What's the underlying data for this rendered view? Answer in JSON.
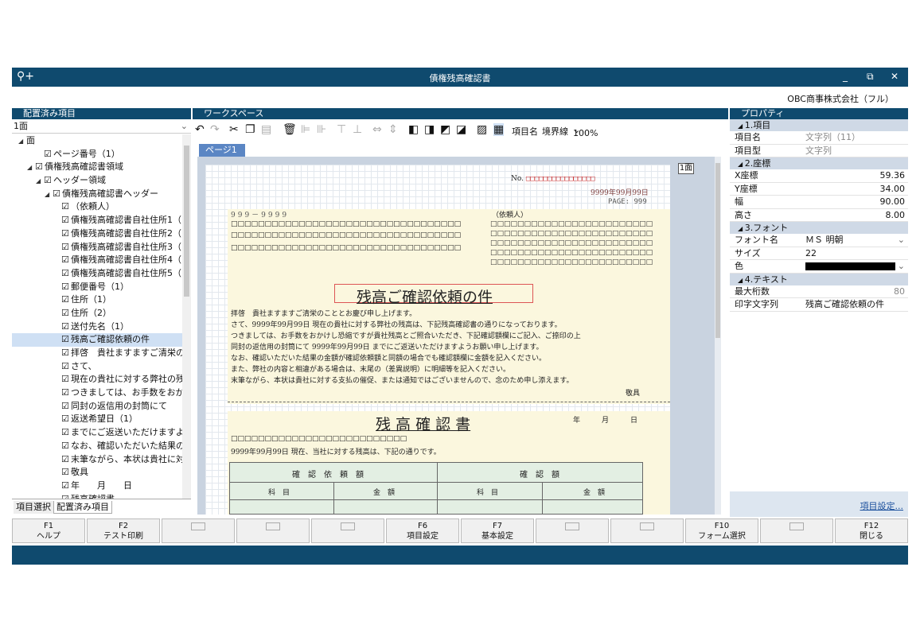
{
  "window": {
    "title": "債権残高確認書",
    "company": "OBC商事株式会社（フル）"
  },
  "left_pane": {
    "header": "配置済み項目",
    "page_select": "1面",
    "tree": [
      {
        "label": "面",
        "level": 0,
        "toggle": "◢",
        "checkbox": false
      },
      {
        "label": "ページ番号（1）",
        "level": 2,
        "toggle": "",
        "checkbox": true
      },
      {
        "label": "債権残高確認書領域",
        "level": 1,
        "toggle": "◢",
        "checkbox": true
      },
      {
        "label": "ヘッダー領域",
        "level": 2,
        "toggle": "◢",
        "checkbox": true
      },
      {
        "label": "債権残高確認書ヘッダー",
        "level": 3,
        "toggle": "◢",
        "checkbox": true
      },
      {
        "label": "（依頼人）",
        "level": 4,
        "toggle": "",
        "checkbox": true
      },
      {
        "label": "債権残高確認書自社住所1（",
        "level": 4,
        "toggle": "",
        "checkbox": true
      },
      {
        "label": "債権残高確認書自社住所2（",
        "level": 4,
        "toggle": "",
        "checkbox": true
      },
      {
        "label": "債権残高確認書自社住所3（",
        "level": 4,
        "toggle": "",
        "checkbox": true
      },
      {
        "label": "債権残高確認書自社住所4（",
        "level": 4,
        "toggle": "",
        "checkbox": true
      },
      {
        "label": "債権残高確認書自社住所5（",
        "level": 4,
        "toggle": "",
        "checkbox": true
      },
      {
        "label": "郵便番号（1）",
        "level": 4,
        "toggle": "",
        "checkbox": true
      },
      {
        "label": "住所（1）",
        "level": 4,
        "toggle": "",
        "checkbox": true
      },
      {
        "label": "住所（2）",
        "level": 4,
        "toggle": "",
        "checkbox": true
      },
      {
        "label": "送付先名（1）",
        "level": 4,
        "toggle": "",
        "checkbox": true
      },
      {
        "label": "残高ご確認依頼の件",
        "level": 4,
        "toggle": "",
        "checkbox": true,
        "selected": true
      },
      {
        "label": "拝啓　貴社ますますご清栄の",
        "level": 4,
        "toggle": "",
        "checkbox": true
      },
      {
        "label": "さて、",
        "level": 4,
        "toggle": "",
        "checkbox": true
      },
      {
        "label": "現在の貴社に対する弊社の残",
        "level": 4,
        "toggle": "",
        "checkbox": true
      },
      {
        "label": "つきましては、お手数をおか",
        "level": 4,
        "toggle": "",
        "checkbox": true
      },
      {
        "label": "同封の返信用の封筒にて",
        "level": 4,
        "toggle": "",
        "checkbox": true
      },
      {
        "label": "返送希望日（1）",
        "level": 4,
        "toggle": "",
        "checkbox": true
      },
      {
        "label": "までにご返送いただけますよ",
        "level": 4,
        "toggle": "",
        "checkbox": true
      },
      {
        "label": "なお、確認いただいた結果の",
        "level": 4,
        "toggle": "",
        "checkbox": true
      },
      {
        "label": "末筆ながら、本状は貴社に対",
        "level": 4,
        "toggle": "",
        "checkbox": true
      },
      {
        "label": "敬具",
        "level": 4,
        "toggle": "",
        "checkbox": true
      },
      {
        "label": "年　　月　　日",
        "level": 4,
        "toggle": "",
        "checkbox": true
      },
      {
        "label": "残高確認書",
        "level": 4,
        "toggle": "",
        "checkbox": true
      }
    ],
    "tabs": [
      "項目選択",
      "配置済み項目"
    ]
  },
  "workspace": {
    "header": "ワークスペース",
    "toolbar": {
      "item_name_label": "項目名",
      "border_label": "境界線",
      "zoom": "100%"
    },
    "page_tab": "ページ1",
    "page_indicator": "1面",
    "paper": {
      "no_label": "No.",
      "date": "9999年99月99日",
      "page": "PAGE: 999",
      "postal": "999－9999",
      "requester": "（依頼人）",
      "heading": "残高ご確認依頼の件",
      "body": [
        "拝啓　貴社ますますご清栄のこととお慶び申し上げます。",
        "さて、9999年99月99日 現在の貴社に対する弊社の残高は、下記残高確認書の通りになっております。",
        "つきましては、お手数をおかけし恐縮ですが貴社残高とご照合いただき、下記確認額欄にご記入、ご捺印の上",
        "同封の返信用の封筒にて 9999年99月99日 までにご返送いただけますようお願い申し上げます。",
        "なお、確認いただいた結果の金額が確認依頼額と同額の場合でも確認額欄に金額を記入ください。",
        "また、弊社の内容と相違がある場合は、末尾の（差異説明）に明細等を記入ください。",
        "末筆ながら、本状は貴社に対する支払の催促、または通知ではございませんので、念のため申し添えます。"
      ],
      "closing": "敬具",
      "doc_title": "残 高 確 認 書",
      "date_label": "年　　　月　　　日",
      "as_of": "9999年99月99日 現在、当社に対する残高は、下記の通りです。",
      "table": {
        "col1": "確　認　依　頼　額",
        "col2": "確　認　額",
        "sub1": "科　目",
        "sub2": "金　額",
        "sub3": "科　目",
        "sub4": "金　額"
      }
    }
  },
  "properties": {
    "header": "プロパティ",
    "sections": [
      {
        "title": "1.項目",
        "rows": [
          {
            "key": "項目名",
            "value": "文字列（11）",
            "grey": true
          },
          {
            "key": "項目型",
            "value": "文字列",
            "grey": true
          }
        ]
      },
      {
        "title": "2.座標",
        "rows": [
          {
            "key": "X座標",
            "value": "59.36",
            "right": true
          },
          {
            "key": "Y座標",
            "value": "34.00",
            "right": true
          },
          {
            "key": "幅",
            "value": "90.00",
            "right": true
          },
          {
            "key": "高さ",
            "value": "8.00",
            "right": true
          }
        ]
      },
      {
        "title": "3.フォント",
        "rows": [
          {
            "key": "フォント名",
            "value": "ＭＳ 明朝",
            "dropdown": true
          },
          {
            "key": "サイズ",
            "value": "22"
          },
          {
            "key": "色",
            "value": "",
            "color": "#000000",
            "dropdown": true
          }
        ]
      },
      {
        "title": "4.テキスト",
        "rows": [
          {
            "key": "最大桁数",
            "value": "80",
            "right": true,
            "grey": true
          },
          {
            "key": "印字文字列",
            "value": "残高ご確認依頼の件"
          }
        ]
      }
    ],
    "settings_link": "項目設定..."
  },
  "fkeys": [
    {
      "key": "F1",
      "label": "ヘルプ"
    },
    {
      "key": "F2",
      "label": "テスト印刷"
    },
    {
      "key": "",
      "label": ""
    },
    {
      "key": "",
      "label": ""
    },
    {
      "key": "",
      "label": ""
    },
    {
      "key": "F6",
      "label": "項目設定"
    },
    {
      "key": "F7",
      "label": "基本設定"
    },
    {
      "key": "",
      "label": ""
    },
    {
      "key": "",
      "label": ""
    },
    {
      "key": "F10",
      "label": "フォーム選択"
    },
    {
      "key": "",
      "label": ""
    },
    {
      "key": "F12",
      "label": "閉じる"
    }
  ]
}
